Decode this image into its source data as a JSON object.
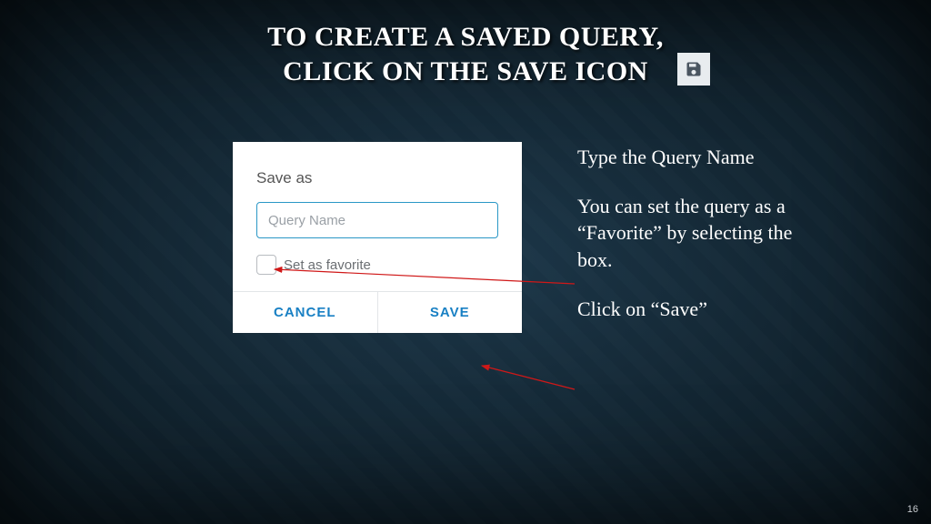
{
  "title": {
    "line1": "TO CREATE A SAVED QUERY,",
    "line2": "CLICK ON THE SAVE ICON"
  },
  "dialog": {
    "heading": "Save as",
    "query_placeholder": "Query Name",
    "favorite_label": "Set as favorite",
    "cancel_label": "CANCEL",
    "save_label": "SAVE"
  },
  "instructions": {
    "p1": "Type the Query Name",
    "p2": "You can set the query as a “Favorite” by selecting the box.",
    "p3": "Click on “Save”"
  },
  "page_number": "16"
}
